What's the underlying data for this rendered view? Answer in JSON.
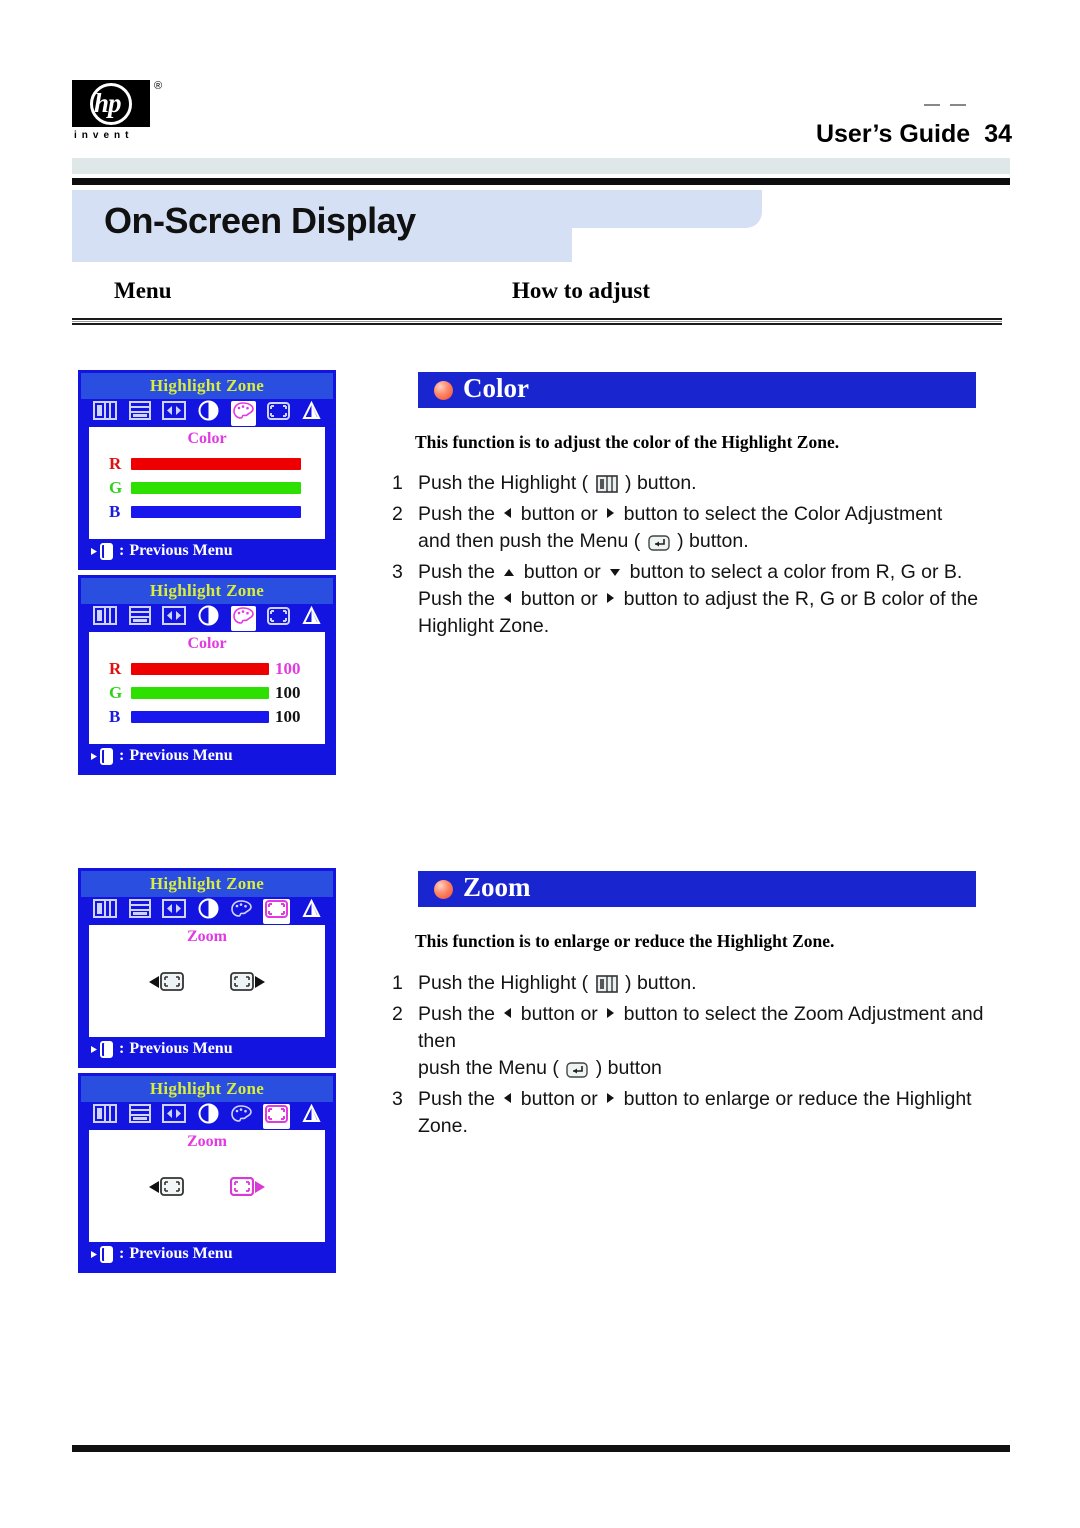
{
  "header": {
    "logo_reg": "®",
    "logo_word": "invent",
    "logo_letters": "hp",
    "guide_label": "User’s Guide",
    "page_number": "34"
  },
  "title": "On-Screen Display",
  "columns": {
    "menu": "Menu",
    "how_to_adjust": "How to adjust"
  },
  "sections": [
    {
      "id": "color",
      "banner": "Color",
      "lead": "This function is to adjust the color of the Highlight Zone.",
      "steps": [
        {
          "num": "1",
          "before": "Push the Highlight (",
          "icon": "highlight-button-icon",
          "after": ") button."
        },
        {
          "num": "2",
          "parts": [
            "Push the ",
            "left-triangle",
            " button or ",
            "right-triangle",
            " button to select the Color Adjustment"
          ],
          "cont_before": "and then push the Menu (",
          "cont_icon": "menu-enter-icon",
          "cont_after": ") button."
        },
        {
          "num": "3",
          "parts": [
            "Push the ",
            "up-triangle",
            " button or ",
            "down-triangle",
            " button to select a color from R, G or B."
          ],
          "cont2a": "Push the ",
          "cont2b": " button or ",
          "cont2c": " button to adjust the R, G or B color of the",
          "cont3": "Highlight Zone."
        }
      ]
    },
    {
      "id": "zoom",
      "banner": "Zoom",
      "lead": "This function is to enlarge or reduce the Highlight Zone.",
      "steps": [
        {
          "num": "1",
          "before": "Push the Highlight (",
          "icon": "highlight-button-icon",
          "after": ") button."
        },
        {
          "num": "2",
          "parts": [
            "Push the ",
            "left-triangle",
            " button or ",
            "right-triangle",
            " button to select the Zoom  Adjustment and then"
          ],
          "cont_before": "push the Menu (",
          "cont_icon": "menu-enter-icon",
          "cont_after": ") button"
        },
        {
          "num": "3",
          "parts": [
            "Push the ",
            "left-triangle",
            " button or ",
            "right-triangle",
            " button to enlarge or reduce the Highlight Zone."
          ]
        }
      ]
    }
  ],
  "osd_panels": [
    {
      "id": "color-osd-unselected",
      "title": "Highlight Zone",
      "body_label": "Color",
      "previous_menu": "Previous Menu",
      "selected_icon_index": 4,
      "icons": [
        "h-position-icon",
        "v-position-icon",
        "width-icon",
        "contrast-icon",
        "palette-icon",
        "zoom-icon",
        "sharpness-icon"
      ],
      "rows": [
        {
          "label": "R",
          "value": "",
          "bar_pct": 100,
          "color": "#ee0000",
          "value_selected": false
        },
        {
          "label": "G",
          "value": "",
          "bar_pct": 100,
          "color": "#2ee000",
          "value_selected": false
        },
        {
          "label": "B",
          "value": "",
          "bar_pct": 100,
          "color": "#1717ee",
          "value_selected": false
        }
      ]
    },
    {
      "id": "color-osd-values",
      "title": "Highlight Zone",
      "body_label": "Color",
      "previous_menu": "Previous Menu",
      "selected_icon_index": 4,
      "icons": [
        "h-position-icon",
        "v-position-icon",
        "width-icon",
        "contrast-icon",
        "palette-icon",
        "zoom-icon",
        "sharpness-icon"
      ],
      "rows": [
        {
          "label": "R",
          "value": "100",
          "bar_pct": 100,
          "color": "#ee0000",
          "value_selected": true
        },
        {
          "label": "G",
          "value": "100",
          "bar_pct": 100,
          "color": "#2ee000",
          "value_selected": false
        },
        {
          "label": "B",
          "value": "100",
          "bar_pct": 100,
          "color": "#1717ee",
          "value_selected": false
        }
      ]
    },
    {
      "id": "zoom-osd-unselected",
      "title": "Highlight Zone",
      "body_label": "Zoom",
      "previous_menu": "Previous Menu",
      "selected_icon_index": 5,
      "icons": [
        "h-position-icon",
        "v-position-icon",
        "width-icon",
        "contrast-icon",
        "palette-icon",
        "zoom-icon",
        "sharpness-icon"
      ],
      "zoom_out_selected": false,
      "zoom_in_selected": false
    },
    {
      "id": "zoom-osd-selected",
      "title": "Highlight Zone",
      "body_label": "Zoom",
      "previous_menu": "Previous Menu",
      "selected_icon_index": 5,
      "icons": [
        "h-position-icon",
        "v-position-icon",
        "width-icon",
        "contrast-icon",
        "palette-icon",
        "zoom-icon",
        "sharpness-icon"
      ],
      "zoom_out_selected": false,
      "zoom_in_selected": true
    }
  ],
  "colors": {
    "osd_blue": "#1414e0",
    "osd_title_blue": "#2a4fe0",
    "osd_title_yellow": "#d9ee3a",
    "magenta": "#e23ae2",
    "banner_blue": "#1926d0",
    "title_band": "#d6e0f5",
    "gray_band": "#dfe7e9"
  }
}
